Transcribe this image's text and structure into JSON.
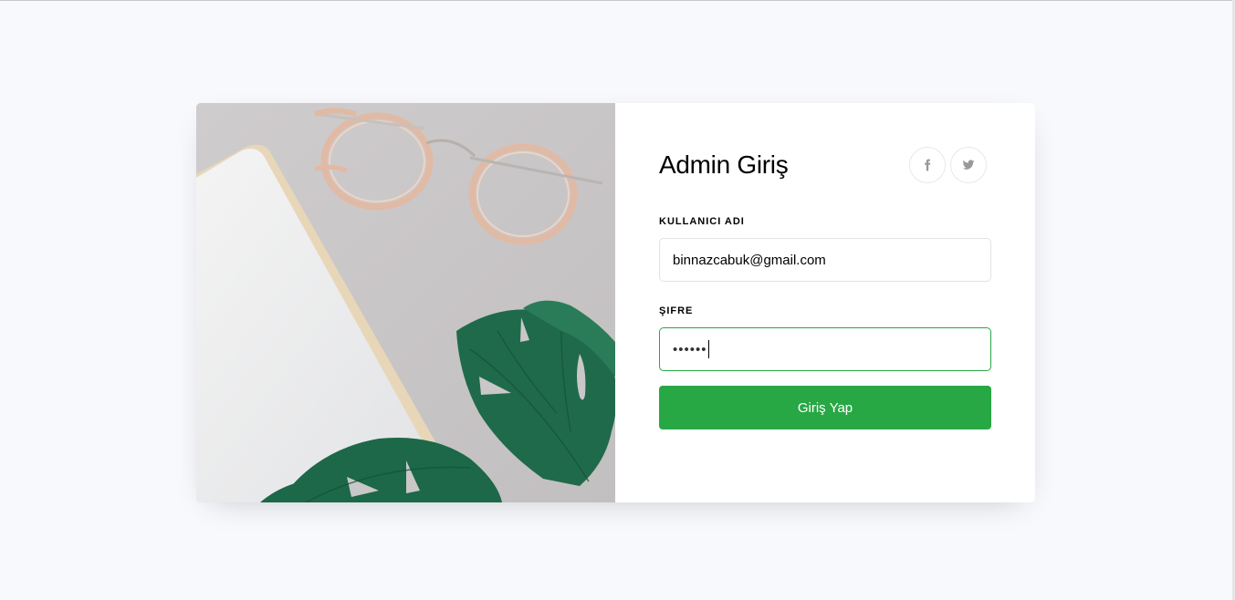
{
  "form": {
    "title": "Admin Giriş",
    "username_label": "KULLANICI ADI",
    "username_value": "binnazcabuk@gmail.com",
    "password_label": "ŞIFRE",
    "password_value": "••••••",
    "submit_label": "Giriş Yap"
  },
  "social": {
    "facebook_icon": "facebook-icon",
    "twitter_icon": "twitter-icon"
  },
  "colors": {
    "background": "#f8f9fd",
    "primary": "#28a745",
    "card": "#ffffff"
  }
}
